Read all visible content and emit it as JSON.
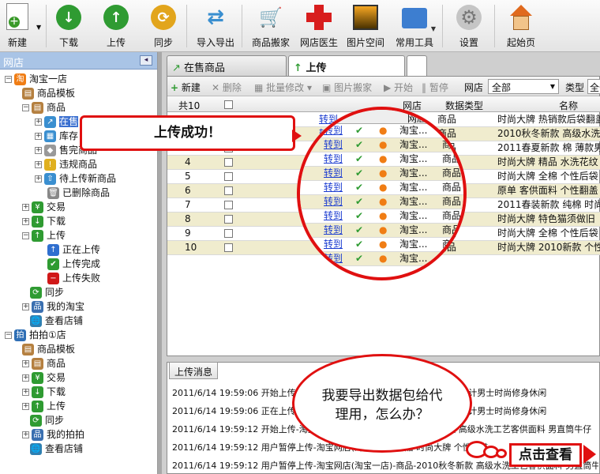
{
  "toolbar": {
    "items": [
      {
        "label": "新建",
        "icon": "new-document-icon"
      },
      {
        "label": "下载",
        "icon": "download-icon"
      },
      {
        "label": "上传",
        "icon": "upload-icon"
      },
      {
        "label": "同步",
        "icon": "sync-icon"
      },
      {
        "label": "导入导出",
        "icon": "import-export-icon"
      },
      {
        "label": "商品搬家",
        "icon": "cart-move-icon"
      },
      {
        "label": "网店医生",
        "icon": "red-cross-icon"
      },
      {
        "label": "图片空间",
        "icon": "picture-icon"
      },
      {
        "label": "常用工具",
        "icon": "tools-folder-icon"
      },
      {
        "label": "设置",
        "icon": "gear-icon"
      },
      {
        "label": "起始页",
        "icon": "home-icon"
      }
    ]
  },
  "sidebar": {
    "title": "网店",
    "shop1": {
      "name": "淘宝一店",
      "children": [
        "商品模板",
        "商品",
        "在售",
        "库存",
        "售完商品",
        "违规商品",
        "待上传新商品",
        "已删除商品",
        "交易",
        "下载",
        "上传",
        "正在上传",
        "上传完成",
        "上传失败",
        "同步",
        "我的淘宝",
        "查看店铺"
      ]
    },
    "shop2": {
      "name": "拍拍①店",
      "children": [
        "商品模板",
        "商品",
        "交易",
        "下载",
        "上传",
        "同步",
        "我的拍拍",
        "查看店铺"
      ]
    }
  },
  "tabs": [
    "在售商品",
    "上传"
  ],
  "grid_toolbar": {
    "new": "新建",
    "delete": "删除",
    "batch_edit": "批量修改",
    "image_move": "图片搬家",
    "start": "开始",
    "pause": "暂停",
    "shop_label": "网店",
    "shop_value": "全部",
    "type_label": "类型",
    "type_value": "全部"
  },
  "columns": [
    "共10",
    "网店",
    "数据类型",
    "名称"
  ],
  "rows": [
    {
      "n": "1",
      "link": "转到",
      "shop": "淘宝...",
      "type": "商品",
      "name": "时尚大牌 热销款后袋翻盖"
    },
    {
      "n": "2",
      "link": "转到",
      "shop": "淘宝...",
      "type": "商品",
      "name": "2010秋冬新款 高级水洗工"
    },
    {
      "n": "3",
      "link": "转到",
      "shop": "淘宝...",
      "type": "商品",
      "name": "2011春夏新款 棉 薄款男"
    },
    {
      "n": "4",
      "link": "转到",
      "shop": "淘宝...",
      "type": "商品",
      "name": "时尚大牌 精品 水洗花纹"
    },
    {
      "n": "5",
      "link": "转到",
      "shop": "淘宝...",
      "type": "商品",
      "name": "时尚大牌 全棉 个性后袋"
    },
    {
      "n": "6",
      "link": "转到",
      "shop": "淘宝...",
      "type": "商品",
      "name": "原单 客供面料 个性翻盖"
    },
    {
      "n": "7",
      "link": "转到",
      "shop": "淘宝...",
      "type": "商品",
      "name": "2011春装新款 纯棉 时尚"
    },
    {
      "n": "8",
      "link": "转到",
      "shop": "淘宝...",
      "type": "商品",
      "name": "时尚大牌 特色猫须做旧"
    },
    {
      "n": "9",
      "link": "转到",
      "shop": "淘宝...",
      "type": "商品",
      "name": "时尚大牌 全棉 个性后袋"
    },
    {
      "n": "10",
      "link": "转到",
      "shop": "淘宝...",
      "type": "商品",
      "name": "时尚大牌 2010新款 个性"
    }
  ],
  "log": {
    "tab": "上传消息",
    "lines": [
      "2011/6/14 19:59:06 开始上传-淘宝网店(淘宝一店)-商品-热销款后袋翻盖设计男士时尚修身休闲",
      "2011/6/14 19:59:06 正在上传-淘宝网店(淘宝一店)-商品-热销款后袋翻盖设计男士时尚修身休闲",
      "2011/6/14 19:59:12 开始上传-淘宝网店(淘宝一店)-商品-2010秋冬新款 高级水洗工艺客供面料 男直筒牛仔",
      "2011/6/14 19:59:12 用户暂停上传-淘宝网店(淘宝一店)-商品-时尚大牌 个性翻盖",
      "2011/6/14 19:59:12 用户暂停上传-淘宝网店(淘宝一店)-商品-2010秋冬新款 高级水洗工艺客供面料 男直筒牛仔"
    ]
  },
  "callouts": {
    "success": "上传成功！",
    "question": "我要导出数据包给代理用，怎么办？",
    "click_view": "点击查看"
  },
  "colors": {
    "red": "#e01010",
    "highlight": "#f0ecce",
    "sidebar_header": "#a9c4e6"
  }
}
